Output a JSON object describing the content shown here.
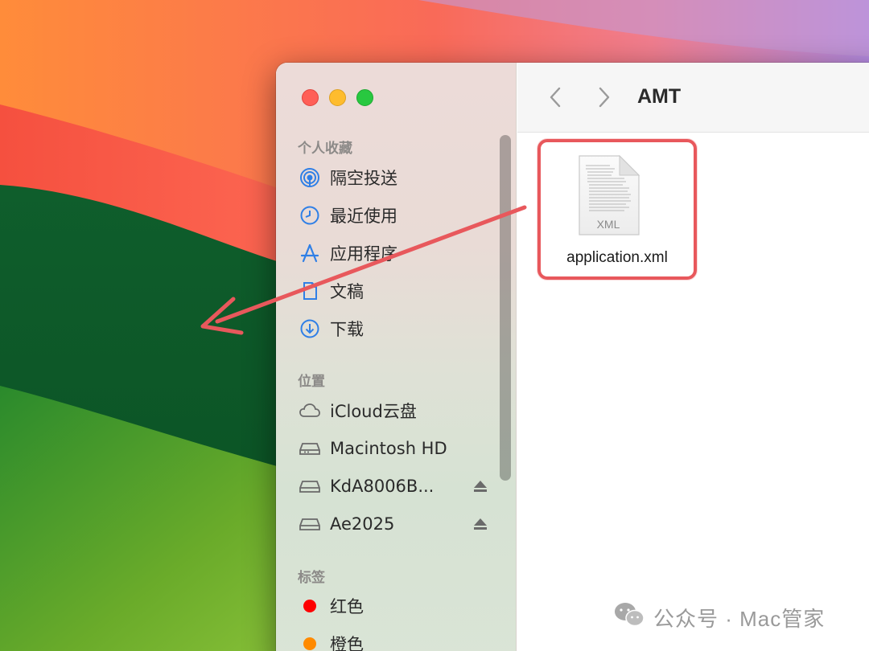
{
  "window": {
    "title": "AMT"
  },
  "sidebar": {
    "favorites_header": "个人收藏",
    "favorites": [
      {
        "label": "隔空投送",
        "icon": "airdrop-icon"
      },
      {
        "label": "最近使用",
        "icon": "clock-icon"
      },
      {
        "label": "应用程序",
        "icon": "applications-icon"
      },
      {
        "label": "文稿",
        "icon": "document-icon"
      },
      {
        "label": "下载",
        "icon": "download-icon"
      }
    ],
    "locations_header": "位置",
    "locations": [
      {
        "label": "iCloud云盘",
        "icon": "cloud-icon",
        "ejectable": false
      },
      {
        "label": "Macintosh HD",
        "icon": "drive-icon",
        "ejectable": false
      },
      {
        "label": "KdA8006B...",
        "icon": "drive-icon",
        "ejectable": true
      },
      {
        "label": "Ae2025",
        "icon": "drive-icon",
        "ejectable": true
      }
    ],
    "tags_header": "标签",
    "tags": [
      {
        "label": "红色",
        "color": "#fe0000"
      },
      {
        "label": "橙色",
        "color": "#ff8a00"
      }
    ]
  },
  "files": [
    {
      "name": "application.xml",
      "type_label": "XML",
      "icon": "xml-file-icon"
    }
  ],
  "watermark": {
    "text": "公众号 · Mac管家",
    "icon": "wechat-icon"
  },
  "colors": {
    "highlight_border": "#e8585c",
    "arrow": "#e8585c"
  }
}
